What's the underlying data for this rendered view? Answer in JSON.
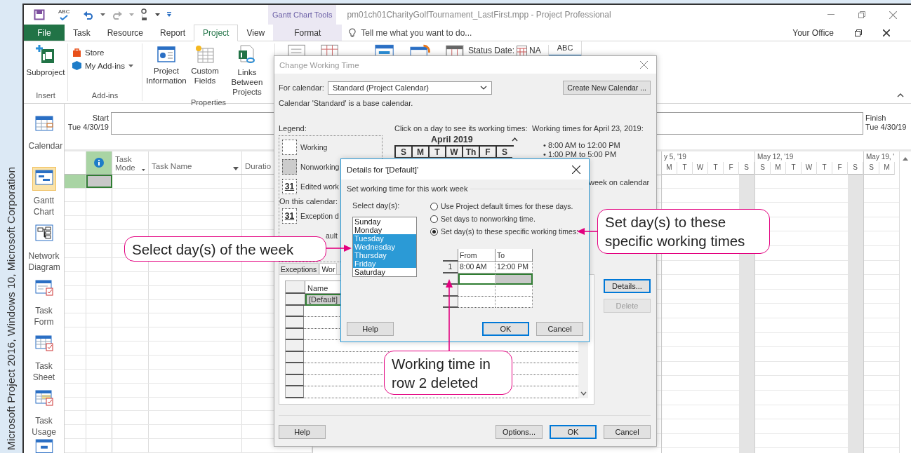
{
  "credit": "Microsoft Project 2016, Windows 10, Microsoft Corporation",
  "quick_access": {
    "spelling_label": "ABC"
  },
  "context_group": "Gantt Chart Tools",
  "window": {
    "title": "pm01ch01CharityGolfTournament_LastFirst.mpp - Project Professional"
  },
  "tabs": [
    {
      "label": "File",
      "kind": "file",
      "selected": false
    },
    {
      "label": "Task",
      "kind": "normal",
      "selected": false
    },
    {
      "label": "Resource",
      "kind": "normal",
      "selected": false
    },
    {
      "label": "Report",
      "kind": "normal",
      "selected": false
    },
    {
      "label": "Project",
      "kind": "normal",
      "selected": true
    },
    {
      "label": "View",
      "kind": "normal",
      "selected": false
    },
    {
      "label": "Format",
      "kind": "context",
      "selected": false
    }
  ],
  "tell_me": {
    "placeholder": "Tell me what you want to do..."
  },
  "account": "Your Office",
  "ribbon": {
    "groups": [
      {
        "label": "Insert",
        "commands": [
          "Subproject"
        ]
      },
      {
        "label": "Add-ins",
        "commands": [
          "Store",
          "My Add-ins"
        ]
      },
      {
        "label": "Properties",
        "commands": [
          "Project Information",
          "Custom Fields",
          "Links Between Projects"
        ]
      }
    ],
    "status_date": {
      "label": "Status Date:",
      "value": "NA"
    },
    "spelling_label": "ABC"
  },
  "views": [
    {
      "label": "Calendar",
      "selected": false
    },
    {
      "label": "Gantt Chart",
      "selected": true
    },
    {
      "label": "Network Diagram",
      "selected": false
    },
    {
      "label": "Task Form",
      "selected": false
    },
    {
      "label": "Task Sheet",
      "selected": false
    },
    {
      "label": "Task Usage",
      "selected": false
    }
  ],
  "timeline": {
    "start_label": "Start",
    "start_date": "Tue 4/30/19",
    "finish_label": "Finish",
    "finish_date": "Tue 4/30/19"
  },
  "task_table": {
    "columns": [
      {
        "label": "Task Mode",
        "dropdown": true
      },
      {
        "label": "Task Name",
        "dropdown": true
      },
      {
        "label": "Duratio"
      }
    ],
    "rows": [
      {
        "selected": true
      }
    ]
  },
  "gantt": {
    "weeks": [
      {
        "label": "y 5, '19",
        "days": [
          {
            "label": "M",
            "nonworking": false
          },
          {
            "label": "T",
            "nonworking": false
          },
          {
            "label": "W",
            "nonworking": false
          },
          {
            "label": "T",
            "nonworking": false
          },
          {
            "label": "F",
            "nonworking": false
          },
          {
            "label": "S",
            "nonworking": true
          }
        ]
      },
      {
        "label": "May 12, '19",
        "days": [
          {
            "label": "S",
            "nonworking": false
          },
          {
            "label": "M",
            "nonworking": false
          },
          {
            "label": "T",
            "nonworking": false
          },
          {
            "label": "W",
            "nonworking": false
          },
          {
            "label": "T",
            "nonworking": false
          },
          {
            "label": "F",
            "nonworking": false
          },
          {
            "label": "S",
            "nonworking": true
          }
        ]
      },
      {
        "label": "May 19, '",
        "days": [
          {
            "label": "S",
            "nonworking": false
          },
          {
            "label": "M",
            "nonworking": false
          }
        ]
      }
    ]
  },
  "change_working_time": {
    "title": "Change Working Time",
    "for_calendar_label": "For calendar:",
    "calendar_value": "Standard (Project Calendar)",
    "create_button": "Create New Calendar ...",
    "base_note": "Calendar 'Standard' is a base calendar.",
    "legend_label": "Legend:",
    "legend": [
      {
        "kind": "working",
        "label": "Working"
      },
      {
        "kind": "nonworking",
        "label": "Nonworking"
      },
      {
        "kind": "edited",
        "mark": "31",
        "label": "Edited work"
      }
    ],
    "on_calendar_label": "On this calendar:",
    "on_calendar": [
      {
        "kind": "exception",
        "mark": "31",
        "label": "Exception d"
      },
      {
        "kind": "nondefault",
        "label": "ault"
      }
    ],
    "month_prompt": "Click on a day to see its working times:",
    "month": "April 2019",
    "weekdays": [
      "S",
      "M",
      "T",
      "W",
      "Th",
      "F",
      "S"
    ],
    "working_times_title": "Working times for April 23, 2019:",
    "working_times": [
      "• 8:00 AM to 12:00 PM",
      "• 1:00 PM to 5:00 PM"
    ],
    "week_note": "week on calendar",
    "tabs": [
      {
        "label": "Exceptions",
        "selected": false
      },
      {
        "label": "Wor",
        "selected": true
      }
    ],
    "table": {
      "columns": [
        "Name"
      ],
      "rows": [
        {
          "name": "[Default]",
          "selected": true
        }
      ]
    },
    "side_buttons": [
      {
        "label": "Details...",
        "kind": "focused",
        "disabled": false
      },
      {
        "label": "Delete",
        "kind": "normal",
        "disabled": true
      }
    ],
    "buttons": [
      {
        "label": "Help",
        "kind": "normal"
      },
      {
        "label": "Options...",
        "kind": "normal"
      },
      {
        "label": "OK",
        "kind": "default"
      },
      {
        "label": "Cancel",
        "kind": "normal"
      }
    ]
  },
  "details": {
    "title": "Details for '[Default]'",
    "section": "Set working time for this work week",
    "days_label": "Select day(s):",
    "days": [
      {
        "label": "Sunday",
        "selected": false
      },
      {
        "label": "Monday",
        "selected": false
      },
      {
        "label": "Tuesday",
        "selected": true
      },
      {
        "label": "Wednesday",
        "selected": true
      },
      {
        "label": "Thursday",
        "selected": true
      },
      {
        "label": "Friday",
        "selected": true
      },
      {
        "label": "Saturday",
        "selected": false
      }
    ],
    "options": [
      {
        "label": "Use Project default times for these days.",
        "selected": false
      },
      {
        "label": "Set days to nonworking time.",
        "selected": false
      },
      {
        "label": "Set day(s) to these specific working times:",
        "selected": true
      }
    ],
    "times": {
      "columns": [
        "From",
        "To"
      ],
      "rows": [
        {
          "number": "1",
          "from": "8:00 AM",
          "to": "12:00 PM",
          "selected": false
        },
        {
          "selected": true
        }
      ]
    },
    "buttons": [
      {
        "label": "Help",
        "kind": "normal"
      },
      {
        "label": "OK",
        "kind": "default"
      },
      {
        "label": "Cancel",
        "kind": "normal"
      }
    ]
  },
  "callouts": [
    {
      "text": "Select day(s) of the week"
    },
    {
      "text": "Set day(s) to these specific working times"
    },
    {
      "text": "Working time in row 2 deleted"
    }
  ]
}
